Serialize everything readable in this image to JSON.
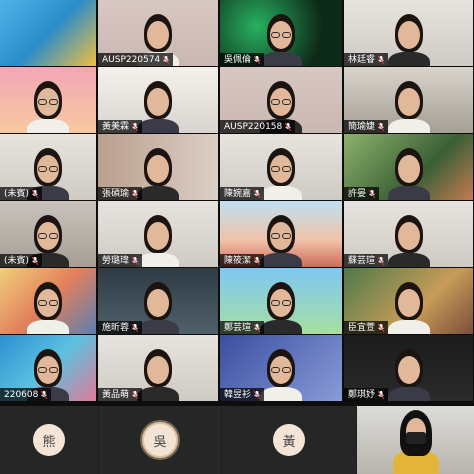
{
  "meeting": {
    "participants": [
      {
        "id": "p1",
        "name": "",
        "tile": "cartoon-dolphin",
        "person": false
      },
      {
        "id": "p2",
        "name": "AUSP220574",
        "tile": "pink-wall",
        "person": true
      },
      {
        "id": "p3",
        "name": "吳佩倫",
        "tile": "dark-green",
        "person": true
      },
      {
        "id": "p4",
        "name": "林廷睿",
        "tile": "white-room",
        "person": true
      },
      {
        "id": "p5",
        "name": "",
        "tile": "pink-cartoon-room",
        "person": true
      },
      {
        "id": "p6",
        "name": "黃美霖",
        "tile": "bright-window",
        "person": true
      },
      {
        "id": "p7",
        "name": "AUSP220158",
        "tile": "pink-wall",
        "person": true
      },
      {
        "id": "p8",
        "name": "簡瑜婕",
        "tile": "office",
        "person": true
      },
      {
        "id": "p9",
        "name": "(未賓)",
        "tile": "white-room",
        "person": true
      },
      {
        "id": "p10",
        "name": "張碩瑜",
        "tile": "door-room",
        "person": true
      },
      {
        "id": "p11",
        "name": "陳婉嘉",
        "tile": "white-room",
        "person": true
      },
      {
        "id": "p12",
        "name": "許晏",
        "tile": "trees",
        "person": true
      },
      {
        "id": "p13",
        "name": "(未賓)",
        "tile": "grey-room",
        "person": true
      },
      {
        "id": "p14",
        "name": "勞璐瑋",
        "tile": "white-room",
        "person": true
      },
      {
        "id": "p15",
        "name": "陳筱潔",
        "tile": "fantasy-castle",
        "person": true
      },
      {
        "id": "p16",
        "name": "蘇芸瑄",
        "tile": "white-room",
        "person": true
      },
      {
        "id": "p17",
        "name": "",
        "tile": "illustration-tea",
        "person": true
      },
      {
        "id": "p18",
        "name": "施昕蓉",
        "tile": "dark-landscape",
        "person": true
      },
      {
        "id": "p19",
        "name": "鄭芸瑄",
        "tile": "sky-game",
        "person": true
      },
      {
        "id": "p20",
        "name": "臣宜萱",
        "tile": "green-painting",
        "person": true
      },
      {
        "id": "p21",
        "name": "220608",
        "tile": "blue-abstract",
        "person": true
      },
      {
        "id": "p22",
        "name": "黃品萌",
        "tile": "white-room",
        "person": true
      },
      {
        "id": "p23",
        "name": "韓昱衫",
        "tile": "blue-poster",
        "person": true
      },
      {
        "id": "p24",
        "name": "鄭琪妤",
        "tile": "dark",
        "person": true
      }
    ],
    "bottom_row": [
      {
        "id": "b1",
        "avatar_text": "熊",
        "speaking": false
      },
      {
        "id": "b2",
        "avatar_text": "吳",
        "speaking": true
      },
      {
        "id": "b3",
        "avatar_text": "黃",
        "speaking": false
      },
      {
        "id": "b4",
        "avatar_text": "",
        "speaking": false,
        "video": true
      }
    ],
    "colors": {
      "label_bg": "#000000",
      "avatar_bg": "#f3e4d6",
      "speaking_ring": "#d9c3a3",
      "bottom_bg": "#1f1f1f"
    }
  }
}
